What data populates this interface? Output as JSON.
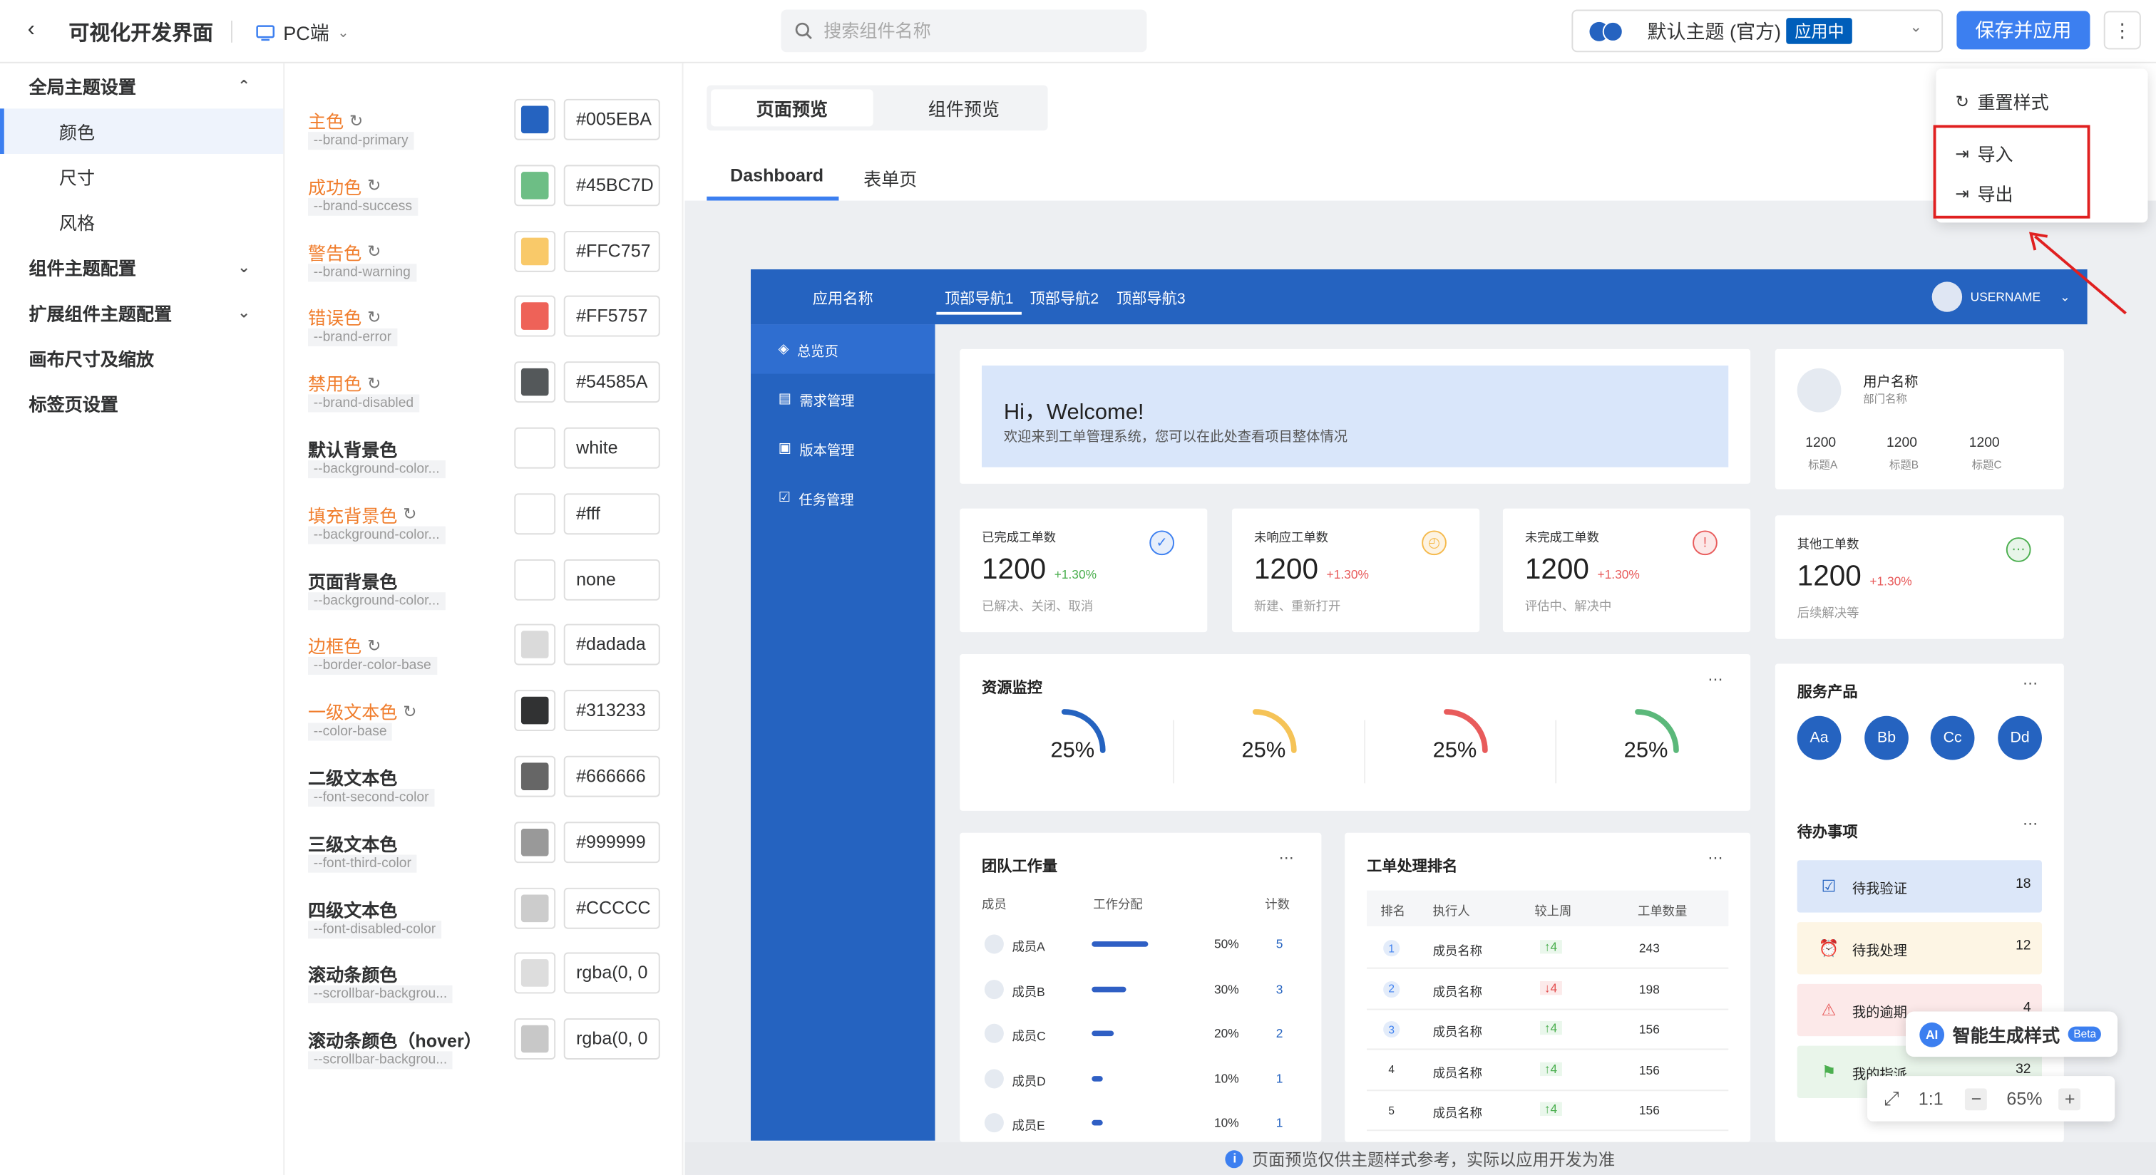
{
  "header": {
    "back_icon": "chevron-left-icon",
    "title": "可视化开发界面",
    "platform": "PC端",
    "search_placeholder": "搜索组件名称",
    "theme_name": "默认主题 (官方)",
    "theme_badge": "应用中",
    "save_label": "保存并应用",
    "more_icon": "more-vertical-icon"
  },
  "nav": {
    "global": "全局主题设置",
    "color": "颜色",
    "size": "尺寸",
    "style": "风格",
    "component": "组件主题配置",
    "ext": "扩展组件主题配置",
    "canvas": "画布尺寸及缩放",
    "tabs": "标签页设置"
  },
  "colors": [
    {
      "name": "主色",
      "var": "--brand-primary",
      "value": "#005EBA",
      "swatch": "#2563C0",
      "accent": true,
      "reset": true
    },
    {
      "name": "成功色",
      "var": "--brand-success",
      "value": "#45BC7D",
      "swatch": "#6DBE85",
      "accent": true,
      "reset": true
    },
    {
      "name": "警告色",
      "var": "--brand-warning",
      "value": "#FFC757",
      "swatch": "#F9C969",
      "accent": true,
      "reset": true
    },
    {
      "name": "错误色",
      "var": "--brand-error",
      "value": "#FF5757",
      "swatch": "#EE6258",
      "accent": true,
      "reset": true
    },
    {
      "name": "禁用色",
      "var": "--brand-disabled",
      "value": "#54585A",
      "swatch": "#54585A",
      "accent": true,
      "reset": true
    },
    {
      "name": "默认背景色",
      "var": "--background-color...",
      "value": "white",
      "swatch": "#FFFFFF",
      "accent": false,
      "reset": false
    },
    {
      "name": "填充背景色",
      "var": "--background-color...",
      "value": "#fff",
      "swatch": "#FFFFFF",
      "accent": true,
      "reset": true
    },
    {
      "name": "页面背景色",
      "var": "--background-color...",
      "value": "none",
      "swatch": "#FFFFFF",
      "accent": false,
      "reset": false
    },
    {
      "name": "边框色",
      "var": "--border-color-base",
      "value": "#dadada",
      "swatch": "#DADADA",
      "accent": true,
      "reset": true
    },
    {
      "name": "一级文本色",
      "var": "--color-base",
      "value": "#313233",
      "swatch": "#313233",
      "accent": true,
      "reset": true
    },
    {
      "name": "二级文本色",
      "var": "--font-second-color",
      "value": "#666666",
      "swatch": "#666666",
      "accent": false,
      "reset": false
    },
    {
      "name": "三级文本色",
      "var": "--font-third-color",
      "value": "#999999",
      "swatch": "#999999",
      "accent": false,
      "reset": false
    },
    {
      "name": "四级文本色",
      "var": "--font-disabled-color",
      "value": "#CCCCC",
      "swatch": "#CCCCCC",
      "accent": false,
      "reset": false
    },
    {
      "name": "滚动条颜色",
      "var": "--scrollbar-backgrou...",
      "value": "rgba(0, 0",
      "swatch": "#DDDDDD",
      "accent": false,
      "reset": false
    },
    {
      "name": "滚动条颜色（hover）",
      "var": "--scrollbar-backgrou...",
      "value": "rgba(0, 0",
      "swatch": "#C8C8C8",
      "accent": false,
      "reset": false
    }
  ],
  "preview": {
    "tab_page": "页面预览",
    "tab_comp": "组件预览",
    "sub_dashboard": "Dashboard",
    "sub_form": "表单页",
    "notice": "页面预览仅供主题样式参考，实际以应用开发为准"
  },
  "app": {
    "name": "应用名称",
    "topnav": [
      "顶部导航1",
      "顶部导航2",
      "顶部导航3"
    ],
    "username": "USERNAME",
    "sidenav": [
      "总览页",
      "需求管理",
      "版本管理",
      "任务管理"
    ],
    "welcome_title": "Hi，Welcome!",
    "welcome_sub": "欢迎来到工单管理系统，您可以在此处查看项目整体情况",
    "profile": {
      "name": "用户名称",
      "dept": "部门名称",
      "stats": [
        {
          "v": "1200",
          "l": "标题A"
        },
        {
          "v": "1200",
          "l": "标题B"
        },
        {
          "v": "1200",
          "l": "标题C"
        }
      ]
    },
    "stats": [
      {
        "label": "已完成工单数",
        "value": "1200",
        "change": "+1.30%",
        "sub": "已解决、关闭、取消",
        "icon": "check-circle-icon",
        "color": "#3C7FF0",
        "bg": "#E6EEFB"
      },
      {
        "label": "未响应工单数",
        "value": "1200",
        "change": "+1.30%",
        "sub": "新建、重新打开",
        "icon": "clock-icon",
        "color": "#F5B94B",
        "bg": "#FDF3E2"
      },
      {
        "label": "未完成工单数",
        "value": "1200",
        "change": "+1.30%",
        "sub": "评估中、解决中",
        "icon": "alert-icon",
        "color": "#E85B5B",
        "bg": "#FCE8E8"
      },
      {
        "label": "其他工单数",
        "value": "1200",
        "change": "+1.30%",
        "sub": "后续解决等",
        "icon": "more-circle-icon",
        "color": "#4CAF50",
        "bg": "#E8F5E9"
      }
    ],
    "monitor_title": "资源监控",
    "gauges": [
      {
        "value": "25%",
        "color": "#2563C0"
      },
      {
        "value": "25%",
        "color": "#F5C357"
      },
      {
        "value": "25%",
        "color": "#E85B5B"
      },
      {
        "value": "25%",
        "color": "#5BB87A"
      }
    ],
    "products_title": "服务产品",
    "products": [
      "Aa",
      "Bb",
      "Cc",
      "Dd"
    ],
    "team_title": "团队工作量",
    "team_headers": [
      "成员",
      "工作分配",
      "计数"
    ],
    "team": [
      {
        "name": "成员A",
        "pct": "50%",
        "count": "5",
        "ratio": 0.5
      },
      {
        "name": "成员B",
        "pct": "30%",
        "count": "3",
        "ratio": 0.3
      },
      {
        "name": "成员C",
        "pct": "20%",
        "count": "2",
        "ratio": 0.2
      },
      {
        "name": "成员D",
        "pct": "10%",
        "count": "1",
        "ratio": 0.1
      },
      {
        "name": "成员E",
        "pct": "10%",
        "count": "1",
        "ratio": 0.1
      }
    ],
    "rank_title": "工单处理排名",
    "rank_headers": [
      "排名",
      "执行人",
      "较上周",
      "工单数量"
    ],
    "ranks": [
      {
        "rank": "1",
        "name": "成员名称",
        "trend": "↑4",
        "dir": "up",
        "count": "243"
      },
      {
        "rank": "2",
        "name": "成员名称",
        "trend": "↓4",
        "dir": "down",
        "count": "198"
      },
      {
        "rank": "3",
        "name": "成员名称",
        "trend": "↑4",
        "dir": "up",
        "count": "156"
      },
      {
        "rank": "4",
        "name": "成员名称",
        "trend": "↑4",
        "dir": "up",
        "count": "156"
      },
      {
        "rank": "5",
        "name": "成员名称",
        "trend": "↑4",
        "dir": "up",
        "count": "156"
      }
    ],
    "todo_title": "待办事项",
    "todos": [
      {
        "label": "待我验证",
        "count": "18",
        "bg": "#DCE7F9",
        "icon": "clipboard-icon"
      },
      {
        "label": "待我处理",
        "count": "12",
        "bg": "#FDF5E4",
        "icon": "alarm-icon"
      },
      {
        "label": "我的逾期",
        "count": "4",
        "bg": "#FCE9E9",
        "icon": "warning-icon"
      },
      {
        "label": "我的指派",
        "count": "32",
        "bg": "#E9F5EA",
        "icon": "flag-icon"
      }
    ]
  },
  "dropdown": {
    "reset": "重置样式",
    "import": "导入",
    "export": "导出"
  },
  "ai": {
    "label": "智能生成样式",
    "beta": "Beta",
    "icon_text": "AI"
  },
  "zoom": {
    "ratio": "1:1",
    "value": "65%"
  }
}
